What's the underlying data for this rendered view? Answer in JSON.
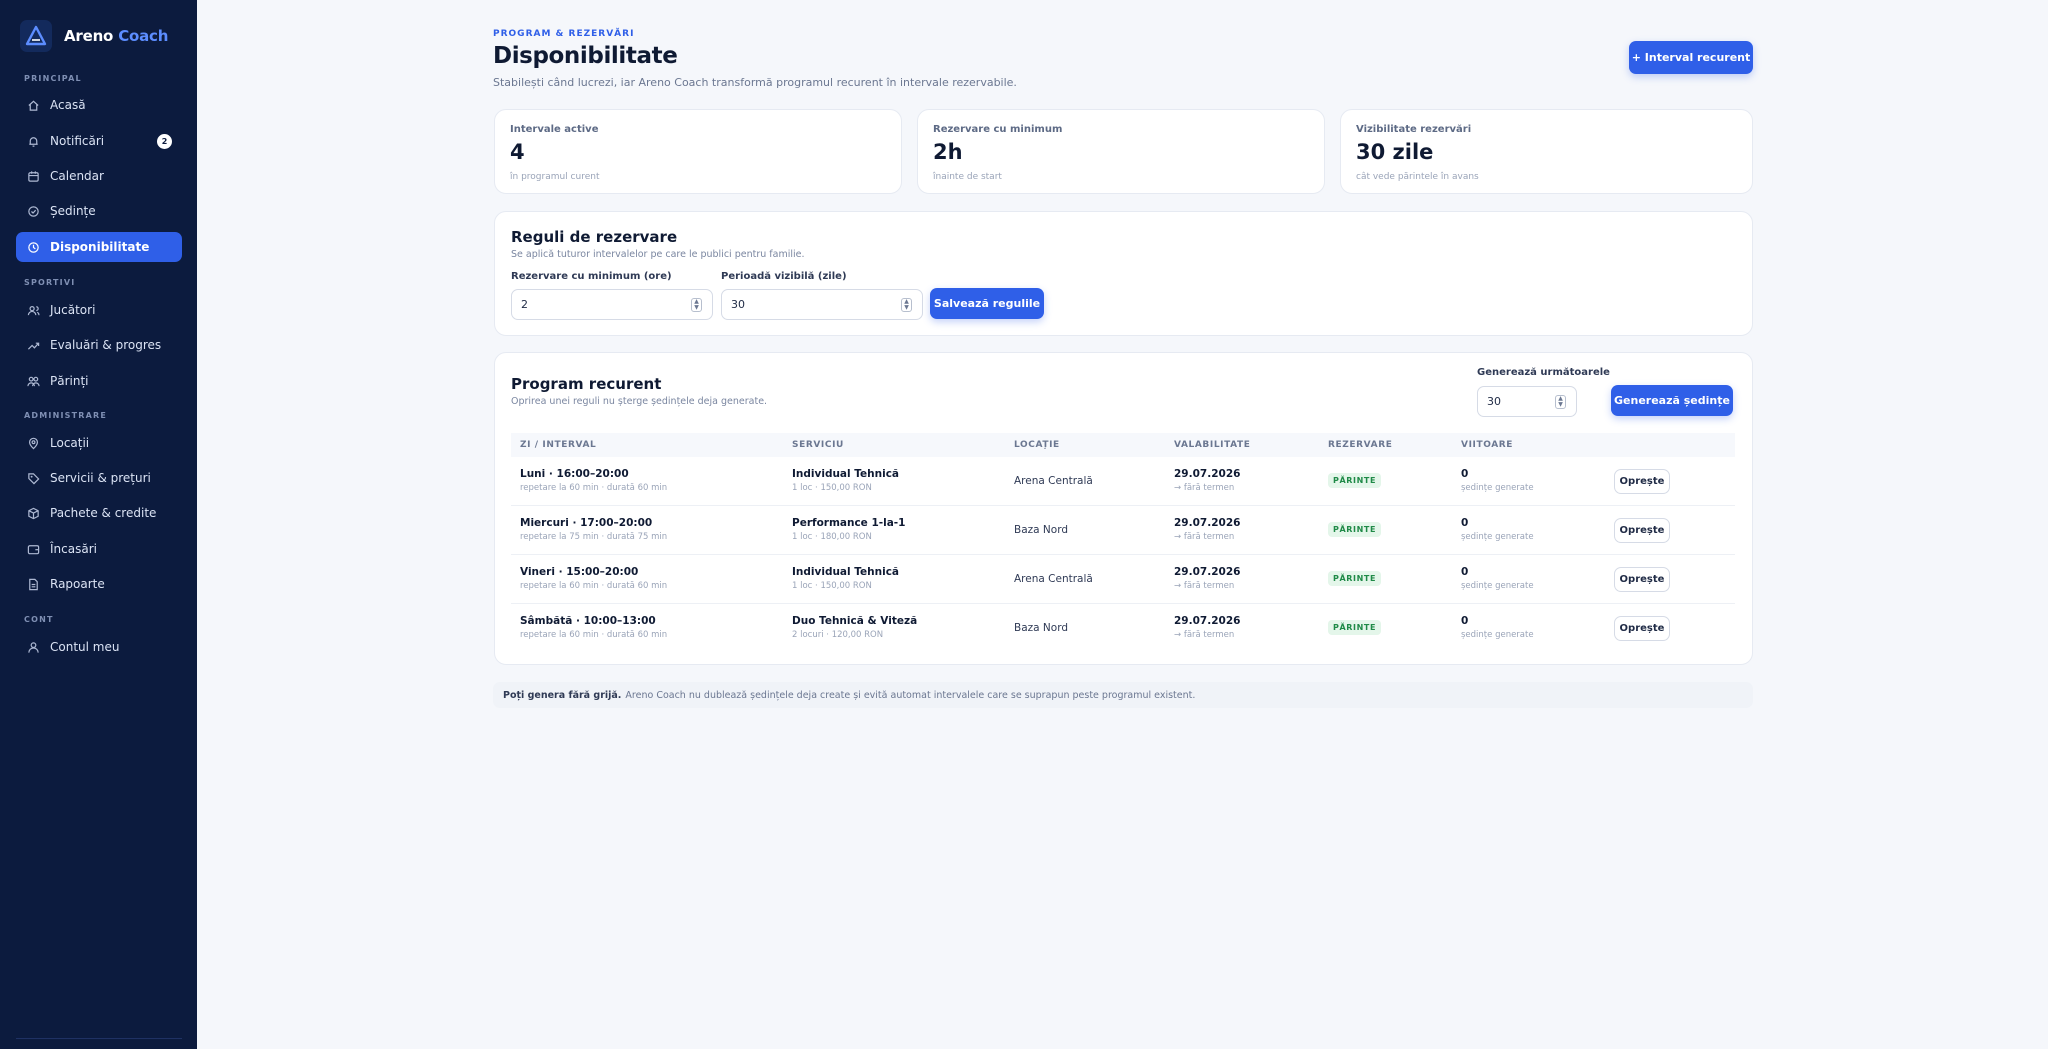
{
  "brand": {
    "name": "Areno",
    "accent": "Coach"
  },
  "sidebar": {
    "sections": {
      "principal": "PRINCIPAL",
      "sportivi": "SPORTIVI",
      "administrare": "ADMINISTRARE",
      "cont": "CONT"
    },
    "items": [
      {
        "label": "Acasă",
        "icon": "home-icon"
      },
      {
        "label": "Notificări",
        "icon": "bell-icon",
        "badge": "2"
      },
      {
        "label": "Calendar",
        "icon": "calendar-icon"
      },
      {
        "label": "Ședințe",
        "icon": "check-circle-icon"
      },
      {
        "label": "Disponibilitate",
        "icon": "clock-icon",
        "active": true
      },
      {
        "label": "Jucători",
        "icon": "users-icon"
      },
      {
        "label": "Evaluări & progres",
        "icon": "trend-icon"
      },
      {
        "label": "Părinți",
        "icon": "parents-icon"
      },
      {
        "label": "Locații",
        "icon": "pin-icon"
      },
      {
        "label": "Servicii & prețuri",
        "icon": "tag-icon"
      },
      {
        "label": "Pachete & credite",
        "icon": "package-icon"
      },
      {
        "label": "Încasări",
        "icon": "wallet-icon"
      },
      {
        "label": "Rapoarte",
        "icon": "report-icon"
      },
      {
        "label": "Contul meu",
        "icon": "user-icon"
      }
    ]
  },
  "header": {
    "eyebrow": "PROGRAM & REZERVĂRI",
    "title": "Disponibilitate",
    "subtitle": "Stabilești când lucrezi, iar Areno Coach transformă programul recurent în intervale rezervabile.",
    "add_button": "+ Interval recurent"
  },
  "stats": [
    {
      "label": "Intervale active",
      "value": "4",
      "note": "în programul curent"
    },
    {
      "label": "Rezervare cu minimum",
      "value": "2h",
      "note": "înainte de start"
    },
    {
      "label": "Vizibilitate rezervări",
      "value": "30 zile",
      "note": "cât vede părintele în avans"
    }
  ],
  "rules": {
    "title": "Reguli de rezervare",
    "subtitle": "Se aplică tuturor intervalelor pe care le publici pentru familie.",
    "min_label": "Rezervare cu minimum (ore)",
    "min_value": "2",
    "period_label": "Perioadă vizibilă (zile)",
    "period_value": "30",
    "save_button": "Salvează regulile"
  },
  "program": {
    "title": "Program recurent",
    "subtitle": "Oprirea unei reguli nu șterge ședințele deja generate.",
    "generate_label": "Generează următoarele",
    "generate_value": "30",
    "generate_button": "Generează ședințe",
    "columns": [
      "ZI / INTERVAL",
      "SERVICIU",
      "LOCAȚIE",
      "VALABILITATE",
      "REZERVARE",
      "VIITOARE"
    ],
    "rows": [
      {
        "day": "Luni · 16:00–20:00",
        "day_sub": "repetare la 60 min · durată 60 min",
        "service": "Individual Tehnică",
        "service_sub": "1 loc · 150,00 RON",
        "location": "Arena Centrală",
        "valid": "29.07.2026",
        "valid_sub": "→ fără termen",
        "booking": "PĂRINTE",
        "future": "0",
        "future_sub": "ședințe generate",
        "action": "Oprește"
      },
      {
        "day": "Miercuri · 17:00–20:00",
        "day_sub": "repetare la 75 min · durată 75 min",
        "service": "Performance 1-la-1",
        "service_sub": "1 loc · 180,00 RON",
        "location": "Baza Nord",
        "valid": "29.07.2026",
        "valid_sub": "→ fără termen",
        "booking": "PĂRINTE",
        "future": "0",
        "future_sub": "ședințe generate",
        "action": "Oprește"
      },
      {
        "day": "Vineri · 15:00–20:00",
        "day_sub": "repetare la 60 min · durată 60 min",
        "service": "Individual Tehnică",
        "service_sub": "1 loc · 150,00 RON",
        "location": "Arena Centrală",
        "valid": "29.07.2026",
        "valid_sub": "→ fără termen",
        "booking": "PĂRINTE",
        "future": "0",
        "future_sub": "ședințe generate",
        "action": "Oprește"
      },
      {
        "day": "Sâmbătă · 10:00–13:00",
        "day_sub": "repetare la 60 min · durată 60 min",
        "service": "Duo Tehnică & Viteză",
        "service_sub": "2 locuri · 120,00 RON",
        "location": "Baza Nord",
        "valid": "29.07.2026",
        "valid_sub": "→ fără termen",
        "booking": "PĂRINTE",
        "future": "0",
        "future_sub": "ședințe generate",
        "action": "Oprește"
      }
    ]
  },
  "footnote": {
    "bold": "Poți genera fără grijă.",
    "text": "Areno Coach nu dublează ședințele deja create și evită automat intervalele care se suprapun peste programul existent."
  },
  "colors": {
    "sidebar_bg": "#0c1b3e",
    "accent": "#2f5fe8",
    "page_bg": "#f5f7fb",
    "pill_bg": "#e4f6ea",
    "pill_text": "#1f8a47"
  }
}
